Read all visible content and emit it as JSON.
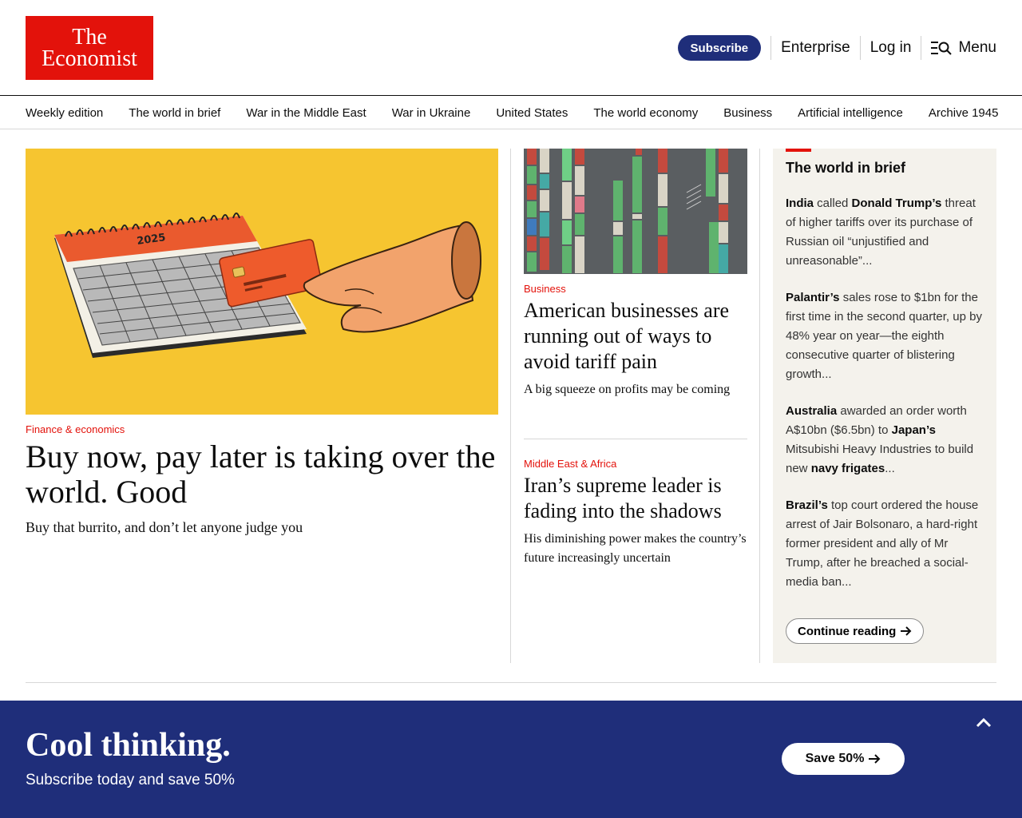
{
  "header": {
    "logo_line1": "The",
    "logo_line2": "Economist",
    "subscribe_label": "Subscribe",
    "enterprise_label": "Enterprise",
    "login_label": "Log in",
    "menu_label": "Menu"
  },
  "nav": {
    "items": [
      "Weekly edition",
      "The world in brief",
      "War in the Middle East",
      "War in Ukraine",
      "United States",
      "The world economy",
      "Business",
      "Artificial intelligence",
      "Archive 1945"
    ]
  },
  "lead": {
    "kicker": "Finance & economics",
    "title": "Buy now, pay later is taking over the world. Good",
    "subtitle": "Buy that burrito, and don’t let anyone judge you",
    "image_calendar_year": "2025"
  },
  "middle": {
    "story1": {
      "kicker": "Business",
      "title": "American businesses are running out of ways to avoid tariff pain",
      "subtitle": "A big squeeze on profits may be coming"
    },
    "story2": {
      "kicker": "Middle East & Africa",
      "title": "Iran’s supreme leader is fading into the shadows",
      "subtitle": "His diminishing power makes the country’s future increasingly uncertain"
    }
  },
  "brief": {
    "title": "The world in brief",
    "items": [
      [
        [
          "b",
          "India"
        ],
        [
          "t",
          " called "
        ],
        [
          "b",
          "Donald Trump’s"
        ],
        [
          "t",
          " threat of higher tariffs over its purchase of Russian oil “unjustified and unreasonable”..."
        ]
      ],
      [
        [
          "b",
          "Palantir’s"
        ],
        [
          "t",
          " sales rose to $1bn for the first time in the second quarter, up by 48% year on year—the eighth consecutive quarter of blistering growth..."
        ]
      ],
      [
        [
          "b",
          "Australia"
        ],
        [
          "t",
          " awarded an order worth A$10bn ($6.5bn) to "
        ],
        [
          "b",
          "Japan’s"
        ],
        [
          "t",
          " Mitsubishi Heavy Industries to build new "
        ],
        [
          "b",
          "navy frigates"
        ],
        [
          "t",
          "..."
        ]
      ],
      [
        [
          "b",
          "Brazil’s"
        ],
        [
          "t",
          " top court ordered the house arrest of Jair Bolsonaro, a hard-right former president and ally of Mr Trump, after he breached a social-media ban..."
        ]
      ]
    ],
    "continue_label": "Continue reading"
  },
  "promo": {
    "title": "Cool thinking.",
    "subtitle": "Subscribe today and save 50%",
    "cta_label": "Save 50%"
  },
  "colors": {
    "brand_red": "#e3120b",
    "navy": "#1f2e7a",
    "brief_bg": "#f4f2ec",
    "lead_image_bg": "#f6c530"
  },
  "icons": {
    "menu": "search-menu-icon",
    "arrow": "arrow-right-icon",
    "collapse": "chevron-up-icon"
  }
}
